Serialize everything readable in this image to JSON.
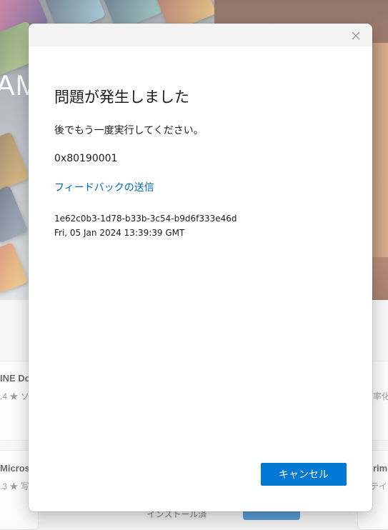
{
  "background": {
    "hero_text": "AM",
    "card_left_1": {
      "title": "INE Do",
      "rating": ".4",
      "extra": "ソ"
    },
    "card_right_1": {
      "extra": "率化"
    },
    "card_left_2": {
      "title": "Microso",
      "rating": ".3",
      "extra": "写"
    },
    "card_right_2": {
      "title": "rim",
      "extra": "テイ"
    },
    "install_button_label": "インストール済み"
  },
  "dialog": {
    "title": "問題が発生しました",
    "message": "後でもう一度実行してください。",
    "error_code": "0x80190001",
    "feedback_link": "フィードバックの送信",
    "correlation_id": "1e62c0b3-1d78-b33b-3c54-b9d6f333e46d",
    "timestamp": "Fri, 05 Jan 2024 13:39:39 GMT",
    "cancel_label": "キャンセル",
    "close_icon": "close-icon"
  },
  "colors": {
    "accent": "#0078d4",
    "link": "#0067c0",
    "titlebar": "#f3f3f3"
  }
}
